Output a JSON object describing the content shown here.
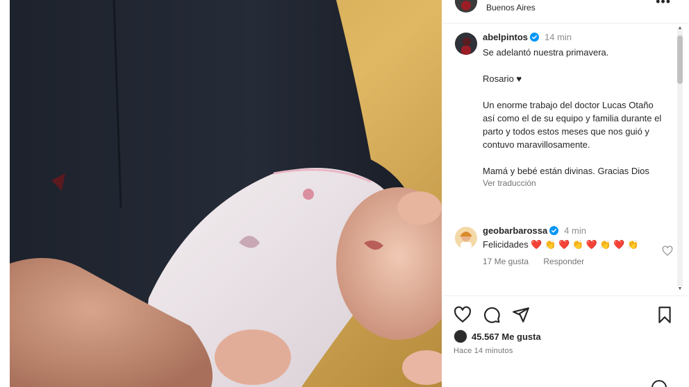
{
  "post": {
    "location": "Buenos Aires",
    "more_label": "•••"
  },
  "caption": {
    "username": "abelpintos",
    "time": "14 min",
    "text": "Se adelantó nuestra primavera.\n\nRosario ♥\n\nUn enorme trabajo del doctor Lucas Otaño así como el de su equipo y familia durante el parto y todos estos meses que nos guió y contuvo maravillosamente.\n\nMamá y bebé están divinas. Gracias Dios",
    "see_translation": "Ver traducción"
  },
  "comment": {
    "username": "geobarbarossa",
    "time": "4 min",
    "text": "Felicidades ❤️ 👏 ❤️ 👏 ❤️ 👏 ❤️ 👏",
    "likes": "17 Me gusta",
    "reply": "Responder"
  },
  "actions": {
    "like_count": "45.567 Me gusta",
    "posted": "Hace 14 minutos"
  },
  "icons": {
    "like": "heart-icon",
    "comment": "comment-icon",
    "share": "share-icon",
    "save": "bookmark-icon",
    "verified": "verified-badge-icon",
    "emoji": "emoji-icon"
  },
  "colors": {
    "verified_blue": "#0095f6",
    "heart_red": "#e0245e",
    "muted_text": "#737373"
  }
}
